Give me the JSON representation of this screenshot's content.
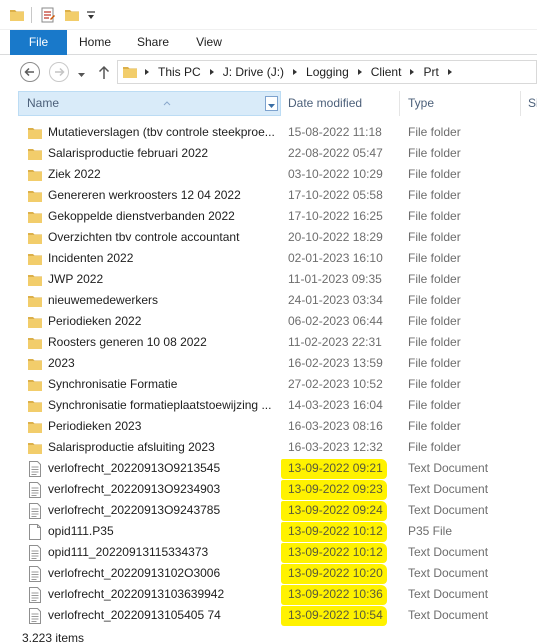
{
  "colors": {
    "accent": "#1979ca",
    "folder": "#dcb04a",
    "highlight": "#fff200",
    "header_selected": "#d9ebf9"
  },
  "quick_access": {
    "icons": [
      "folder-icon",
      "properties-icon",
      "new-folder-icon",
      "customize-dropdown-icon"
    ]
  },
  "ribbon": {
    "tabs": [
      {
        "label": "File",
        "active": true
      },
      {
        "label": "Home",
        "active": false
      },
      {
        "label": "Share",
        "active": false
      },
      {
        "label": "View",
        "active": false
      }
    ]
  },
  "address": {
    "crumbs": [
      "This PC",
      "J: Drive (J:)",
      "Logging",
      "Client",
      "Prt"
    ]
  },
  "columns": {
    "name": "Name",
    "date": "Date modified",
    "type": "Type",
    "size": "Si"
  },
  "files": [
    {
      "name": "Mutatieverslagen (tbv controle steekproe...",
      "date": "15-08-2022 11:18",
      "type": "File folder",
      "icon": "folder-icon",
      "highlighted": false
    },
    {
      "name": "Salarisproductie februari 2022",
      "date": "22-08-2022 05:47",
      "type": "File folder",
      "icon": "folder-icon",
      "highlighted": false
    },
    {
      "name": "Ziek 2022",
      "date": "03-10-2022 10:29",
      "type": "File folder",
      "icon": "folder-icon",
      "highlighted": false
    },
    {
      "name": "Genereren werkroosters 12 04 2022",
      "date": "17-10-2022 05:58",
      "type": "File folder",
      "icon": "folder-icon",
      "highlighted": false
    },
    {
      "name": "Gekoppelde dienstverbanden 2022",
      "date": "17-10-2022 16:25",
      "type": "File folder",
      "icon": "folder-icon",
      "highlighted": false
    },
    {
      "name": "Overzichten tbv controle accountant",
      "date": "20-10-2022 18:29",
      "type": "File folder",
      "icon": "folder-icon",
      "highlighted": false
    },
    {
      "name": "Incidenten 2022",
      "date": "02-01-2023 16:10",
      "type": "File folder",
      "icon": "folder-icon",
      "highlighted": false
    },
    {
      "name": "JWP 2022",
      "date": "11-01-2023 09:35",
      "type": "File folder",
      "icon": "folder-icon",
      "highlighted": false
    },
    {
      "name": "nieuwemedewerkers",
      "date": "24-01-2023 03:34",
      "type": "File folder",
      "icon": "folder-icon",
      "highlighted": false
    },
    {
      "name": "Periodieken 2022",
      "date": "06-02-2023 06:44",
      "type": "File folder",
      "icon": "folder-icon",
      "highlighted": false
    },
    {
      "name": "Roosters generen 10 08 2022",
      "date": "11-02-2023 22:31",
      "type": "File folder",
      "icon": "folder-icon",
      "highlighted": false
    },
    {
      "name": "2023",
      "date": "16-02-2023 13:59",
      "type": "File folder",
      "icon": "folder-icon",
      "highlighted": false
    },
    {
      "name": "Synchronisatie Formatie",
      "date": "27-02-2023 10:52",
      "type": "File folder",
      "icon": "folder-icon",
      "highlighted": false
    },
    {
      "name": "Synchronisatie formatieplaatstoewijzing ...",
      "date": "14-03-2023 16:04",
      "type": "File folder",
      "icon": "folder-icon",
      "highlighted": false
    },
    {
      "name": "Periodieken 2023",
      "date": "16-03-2023 08:16",
      "type": "File folder",
      "icon": "folder-icon",
      "highlighted": false
    },
    {
      "name": "Salarisproductie afsluiting 2023",
      "date": "16-03-2023 12:32",
      "type": "File folder",
      "icon": "folder-icon",
      "highlighted": false
    },
    {
      "name": "verlofrecht_20220913O9213545",
      "date": "13-09-2022 09:21",
      "type": "Text Document",
      "icon": "text-document-icon",
      "highlighted": true
    },
    {
      "name": "verlofrecht_20220913O9234903",
      "date": "13-09-2022 09:23",
      "type": "Text Document",
      "icon": "text-document-icon",
      "highlighted": true
    },
    {
      "name": "verlofrecht_20220913O9243785",
      "date": "13-09-2022 09:24",
      "type": "Text Document",
      "icon": "text-document-icon",
      "highlighted": true
    },
    {
      "name": "opid111.P35",
      "date": "13-09-2022 10:12",
      "type": "P35 File",
      "icon": "blank-file-icon",
      "highlighted": true
    },
    {
      "name": "opid111_20220913115334373",
      "date": "13-09-2022 10:12",
      "type": "Text Document",
      "icon": "text-document-icon",
      "highlighted": true
    },
    {
      "name": "verlofrecht_20220913102O3006",
      "date": "13-09-2022 10:20",
      "type": "Text Document",
      "icon": "text-document-icon",
      "highlighted": true
    },
    {
      "name": "verlofrecht_20220913103639942",
      "date": "13-09-2022 10:36",
      "type": "Text Document",
      "icon": "text-document-icon",
      "highlighted": true
    },
    {
      "name": "verlofrecht_20220913105405 74",
      "date": "13-09-2022 10:54",
      "type": "Text Document",
      "icon": "text-document-icon",
      "highlighted": true
    }
  ],
  "status": {
    "item_count": "3.223 items"
  }
}
